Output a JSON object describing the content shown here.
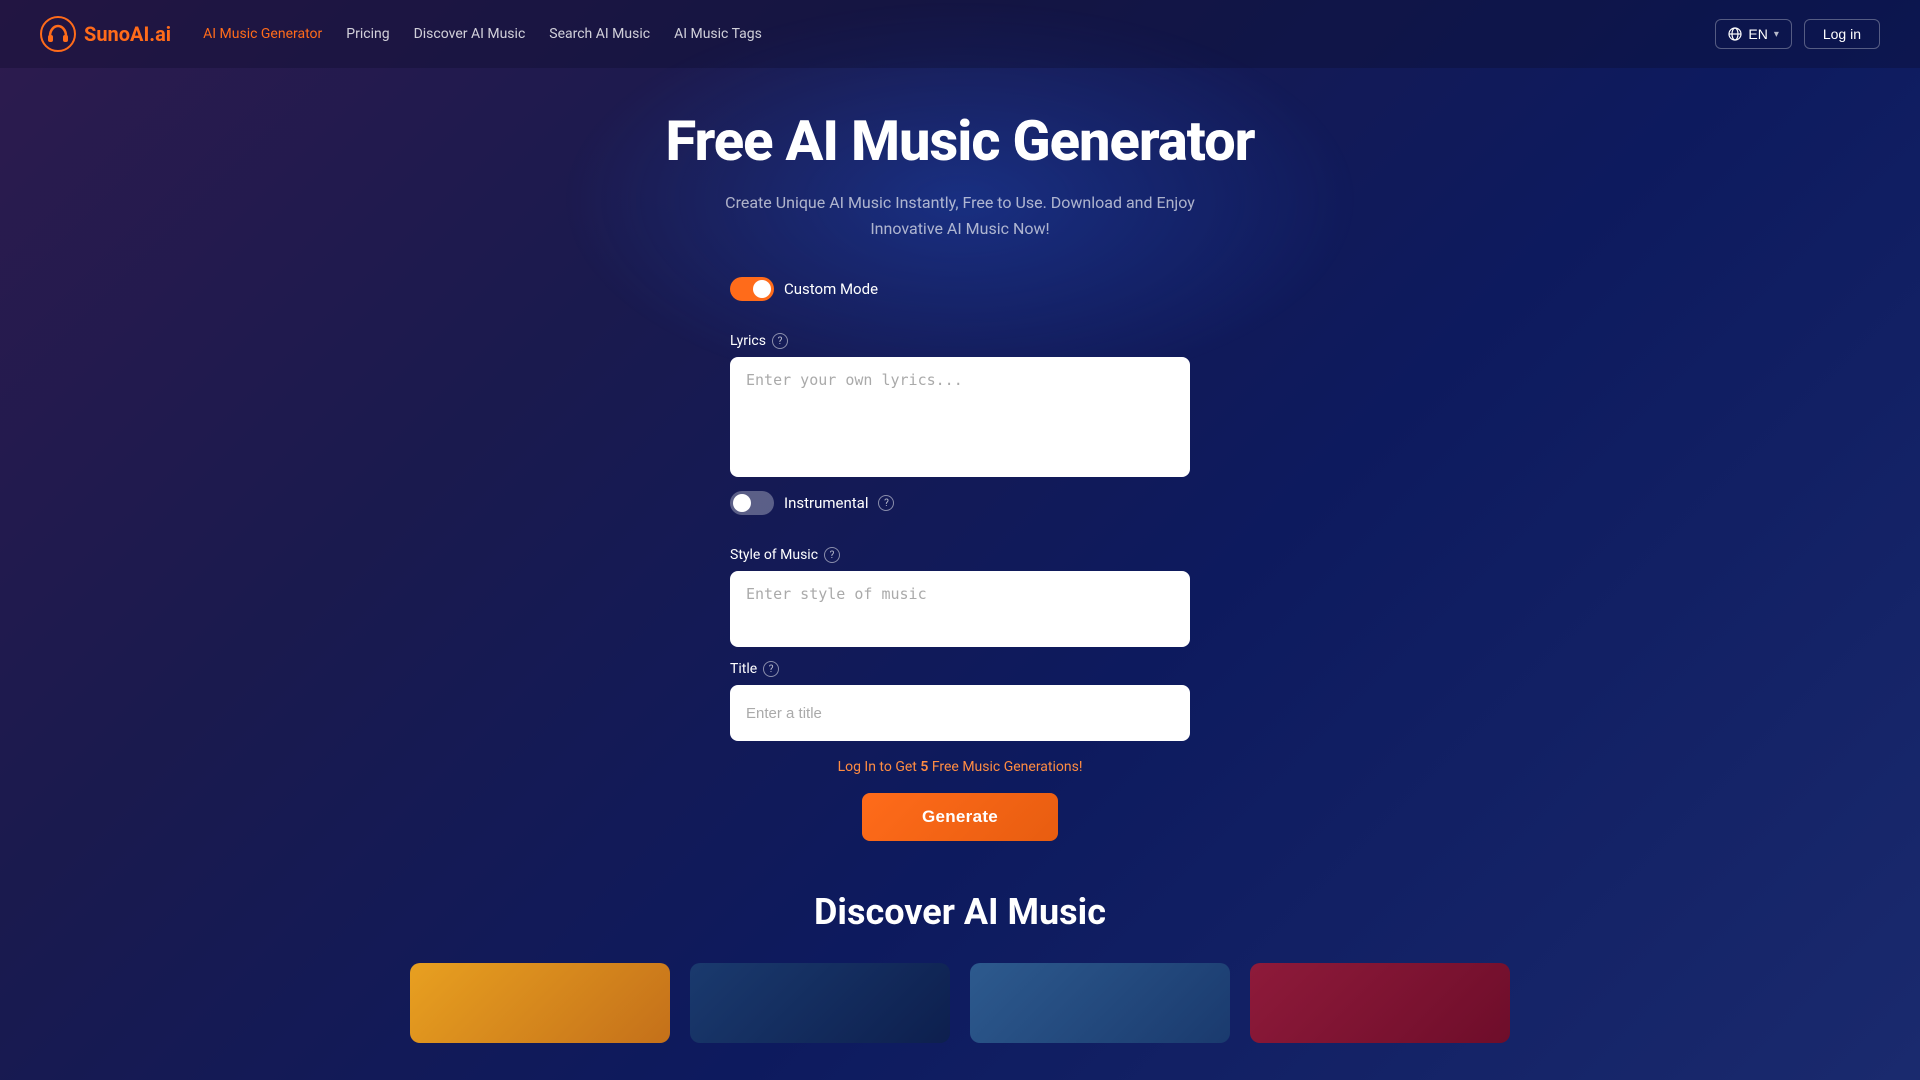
{
  "logo": {
    "text": "SunoAI.ai"
  },
  "nav": {
    "links": [
      {
        "label": "AI Music Generator",
        "active": true
      },
      {
        "label": "Pricing",
        "active": false
      },
      {
        "label": "Discover AI Music",
        "active": false
      },
      {
        "label": "Search AI Music",
        "active": false
      },
      {
        "label": "AI Music Tags",
        "active": false
      }
    ],
    "lang_button": "EN",
    "login_button": "Log in"
  },
  "hero": {
    "title": "Free AI Music Generator",
    "subtitle": "Create Unique AI Music Instantly, Free to Use. Download and Enjoy Innovative AI Music Now!"
  },
  "form": {
    "custom_mode_label": "Custom Mode",
    "custom_mode_on": true,
    "lyrics_label": "Lyrics",
    "lyrics_placeholder": "Enter your own lyrics...",
    "instrumental_label": "Instrumental",
    "instrumental_on": false,
    "style_label": "Style of Music",
    "style_placeholder": "Enter style of music",
    "title_label": "Title",
    "title_placeholder": "Enter a title",
    "login_promo": "Log In to Get 5 Free Music Generations!",
    "login_promo_number": "5",
    "generate_button": "Generate"
  },
  "discover": {
    "title": "Discover AI Music"
  }
}
